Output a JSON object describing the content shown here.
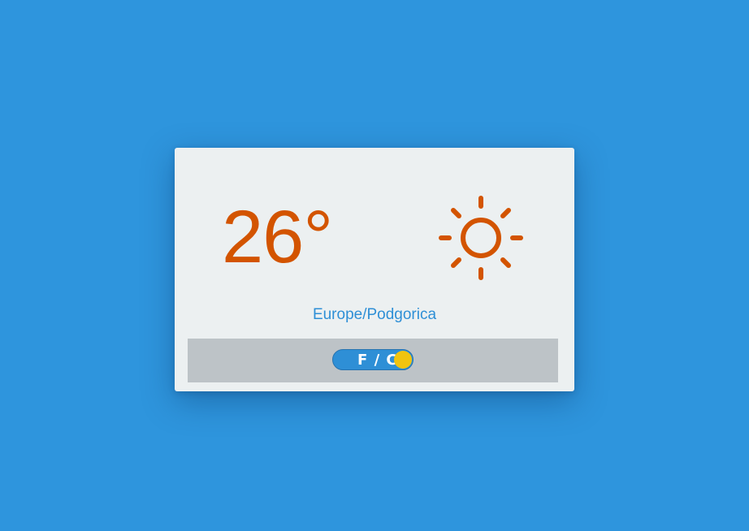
{
  "weather": {
    "temperature": "26°",
    "condition_icon": "sun-icon",
    "location": "Europe/Podgorica",
    "unit_toggle_label": "F / C"
  },
  "colors": {
    "background": "#2e95dd",
    "card": "#ecf0f1",
    "accent": "#d35400",
    "link": "#2e8fd6",
    "footer": "#bdc3c7",
    "knob": "#f1c40f"
  }
}
